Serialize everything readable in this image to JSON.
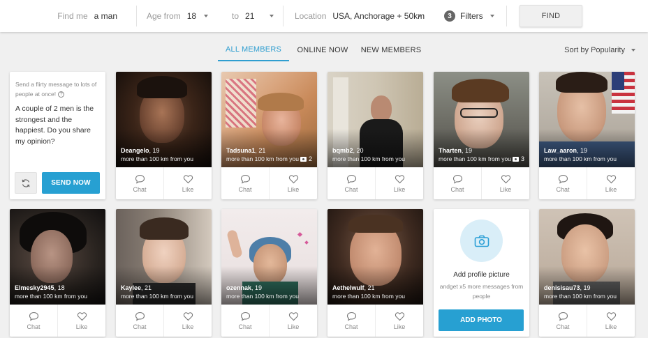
{
  "filters": {
    "find_me_label": "Find me",
    "find_me_value": "a man",
    "age_from_label": "Age from",
    "age_from_value": "18",
    "age_to_label": "to",
    "age_to_value": "21",
    "location_label": "Location",
    "location_value": "USA, Anchorage + 50km",
    "filters_count": "3",
    "filters_label": "Filters",
    "find_button": "FIND"
  },
  "tabs": [
    {
      "label": "ALL MEMBERS",
      "active": true
    },
    {
      "label": "ONLINE NOW",
      "active": false
    },
    {
      "label": "NEW MEMBERS",
      "active": false
    }
  ],
  "sort_label": "Sort by Popularity",
  "message_card": {
    "hint": "Send a flirty message to lots of people at once!",
    "help_glyph": "?",
    "message": "A couple of 2 men is the strongest and the happiest. Do you share my opinion?",
    "send_button": "SEND NOW"
  },
  "actions": {
    "chat": "Chat",
    "like": "Like"
  },
  "members": [
    {
      "name": "Deangelo",
      "age": ", 19",
      "distance": "more than 100 km from you",
      "photos": ""
    },
    {
      "name": "Tadsuna1",
      "age": ", 21",
      "distance": "more than 100 km from you",
      "photos": "2"
    },
    {
      "name": "bqmb2",
      "age": ", 20",
      "distance": "more than 100 km from you",
      "photos": ""
    },
    {
      "name": "Tharten",
      "age": ", 19",
      "distance": "more than 100 km from you",
      "photos": "3"
    },
    {
      "name": "Law_aaron",
      "age": ", 19",
      "distance": "more than 100 km from you",
      "photos": ""
    },
    {
      "name": "Elmesky2945",
      "age": ", 18",
      "distance": "more than 100 km from you",
      "photos": ""
    },
    {
      "name": "Kaylee",
      "age": ", 21",
      "distance": "more than 100 km from you",
      "photos": ""
    },
    {
      "name": "ozennak",
      "age": ", 19",
      "distance": "more than 100 km from you",
      "photos": ""
    },
    {
      "name": "Aethelwulf",
      "age": ", 21",
      "distance": "more than 100 km from you",
      "photos": ""
    },
    {
      "name": "denisisau73",
      "age": ", 19",
      "distance": "more than 100 km from you",
      "photos": ""
    }
  ],
  "add_photo_card": {
    "title": "Add profile picture",
    "subtitle": "andget x5 more messages from people",
    "button": "ADD PHOTO"
  },
  "colors": {
    "accent": "#27a0d2",
    "active_tab": "#2f9ed0"
  }
}
